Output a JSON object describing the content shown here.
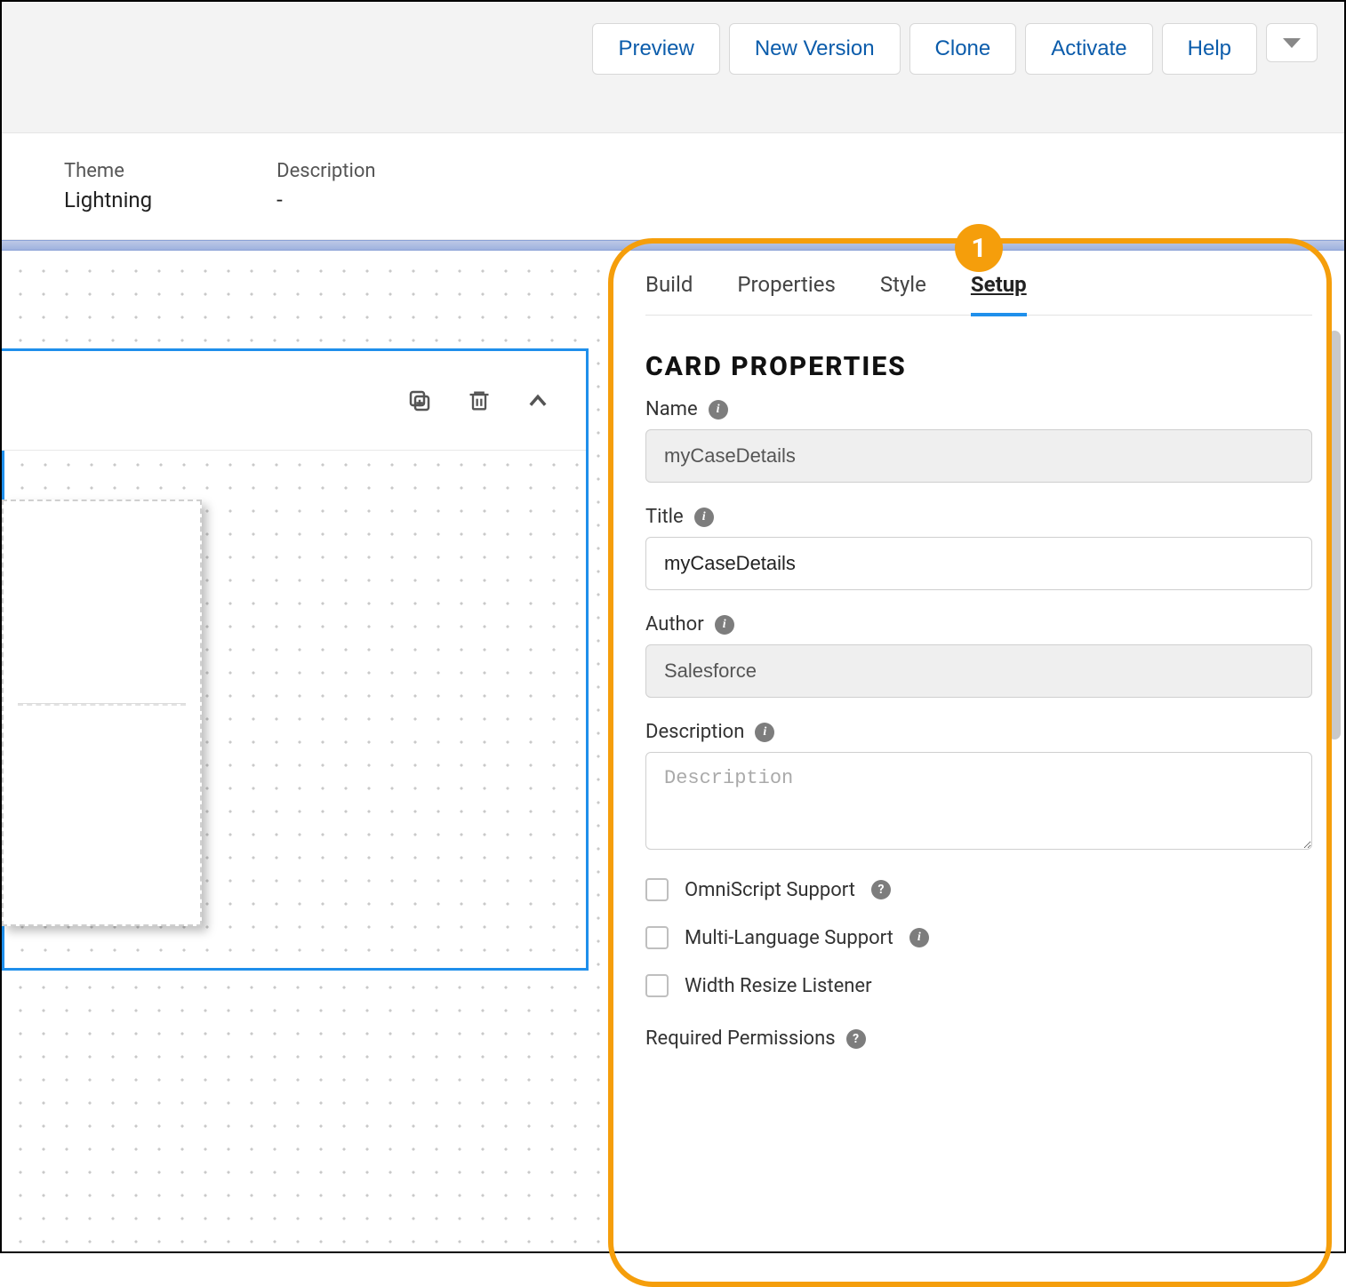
{
  "topbar": {
    "preview": "Preview",
    "newVersion": "New Version",
    "clone": "Clone",
    "activate": "Activate",
    "help": "Help"
  },
  "meta": {
    "themeLabel": "Theme",
    "themeValue": "Lightning",
    "descLabel": "Description",
    "descValue": "-"
  },
  "callout": "1",
  "panel": {
    "tabs": {
      "build": "Build",
      "properties": "Properties",
      "style": "Style",
      "setup": "Setup"
    },
    "sectionTitle": "CARD PROPERTIES",
    "name": {
      "label": "Name",
      "value": "myCaseDetails"
    },
    "title": {
      "label": "Title",
      "value": "myCaseDetails"
    },
    "author": {
      "label": "Author",
      "value": "Salesforce"
    },
    "description": {
      "label": "Description",
      "placeholder": "Description",
      "value": ""
    },
    "checks": {
      "omni": "OmniScript Support",
      "multilang": "Multi-Language Support",
      "widthResize": "Width Resize Listener"
    },
    "requiredPerms": "Required Permissions"
  }
}
